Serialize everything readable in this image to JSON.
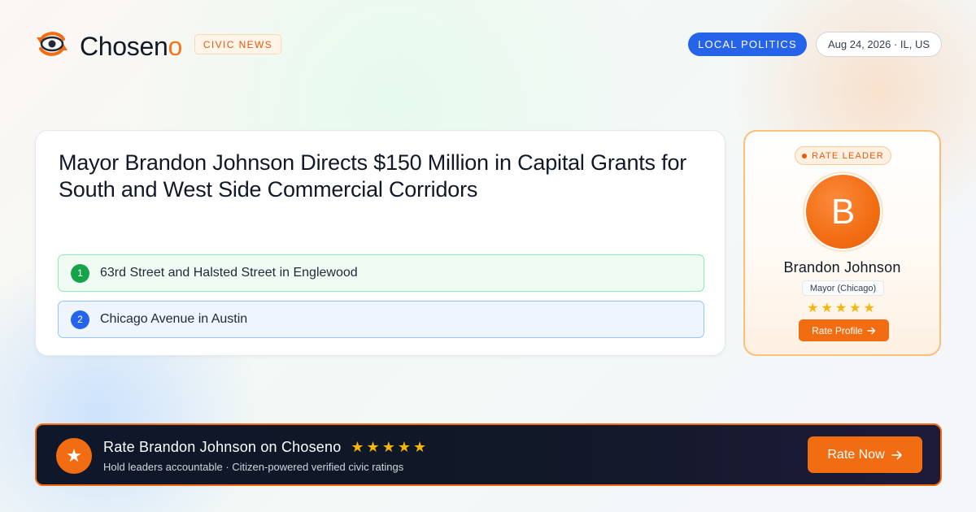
{
  "brand": {
    "name_main": "Chosen",
    "name_accent": "o",
    "badge": "CIVIC NEWS",
    "logo_icon": "eye-refresh-icon",
    "accent_color": "#f26d12"
  },
  "header": {
    "topic": "LOCAL POLITICS",
    "date_location": "Aug 24, 2026 · IL, US",
    "topic_color": "#2563eb"
  },
  "article": {
    "headline": "Mayor Brandon Johnson Directs $150 Million in Capital Grants for South and West Side Commercial Corridors",
    "points": [
      {
        "number": "1",
        "text": "63rd Street and Halsted Street in Englewood"
      },
      {
        "number": "2",
        "text": "Chicago Avenue in Austin"
      }
    ]
  },
  "leader_card": {
    "badge": "RATE LEADER",
    "avatar_initial": "B",
    "name": "Brandon Johnson",
    "role": "Mayor (Chicago)",
    "stars": "★★★★★",
    "button_label": "Rate Profile"
  },
  "cta": {
    "icon": "star-icon",
    "star_glyph": "★",
    "title": "Rate Brandon Johnson on Choseno",
    "stars": "★★★★★",
    "subtitle": "Hold leaders accountable · Citizen-powered verified civic ratings",
    "button_label": "Rate Now"
  }
}
